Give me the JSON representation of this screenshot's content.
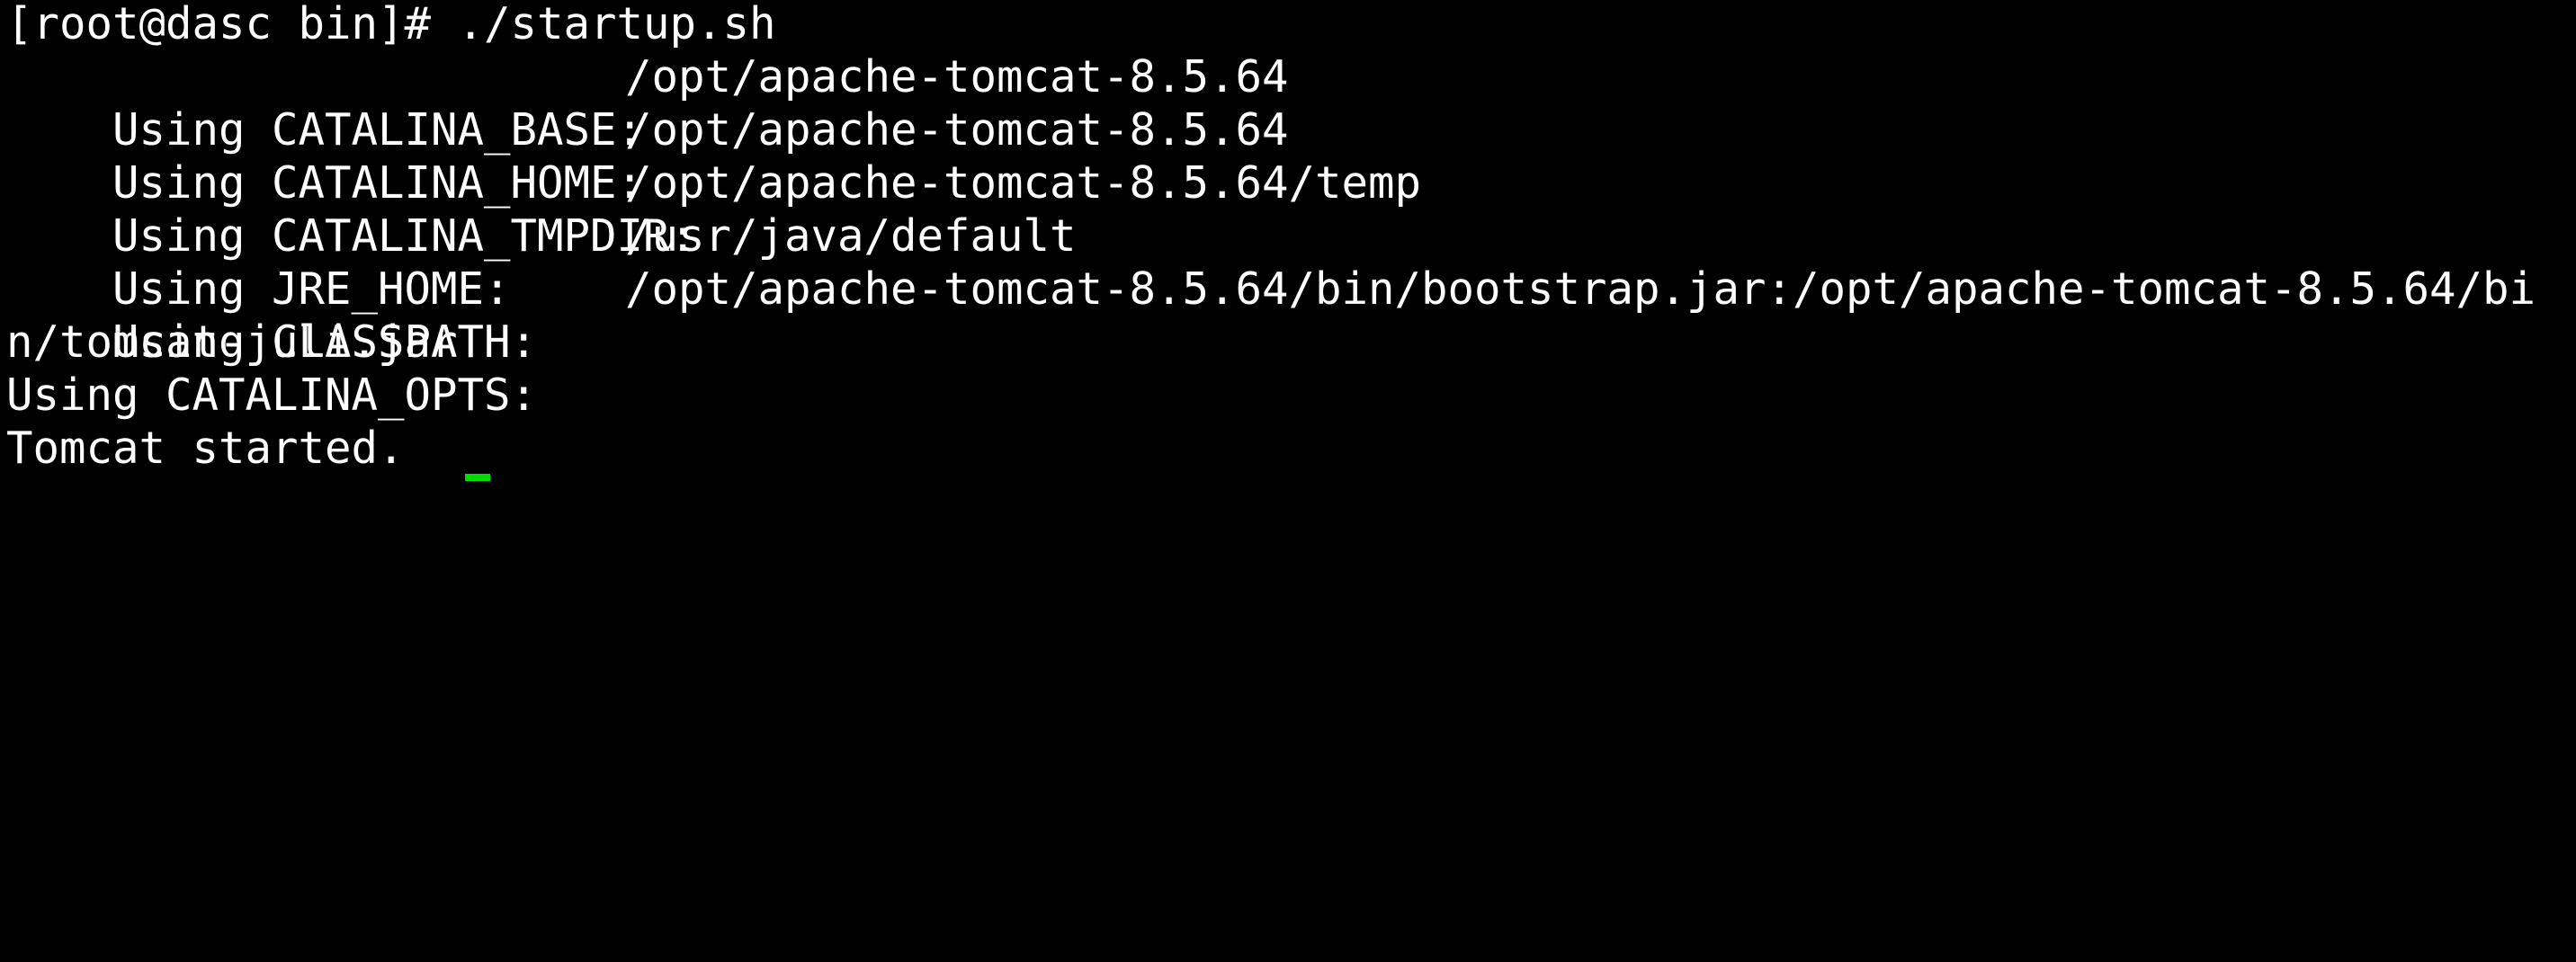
{
  "terminal": {
    "prompt": "[root@dasc bin]# ./startup.sh",
    "env": [
      {
        "label": "Using CATALINA_BASE:",
        "value": "/opt/apache-tomcat-8.5.64"
      },
      {
        "label": "Using CATALINA_HOME:",
        "value": "/opt/apache-tomcat-8.5.64"
      },
      {
        "label": "Using CATALINA_TMPDIR:",
        "value": "/opt/apache-tomcat-8.5.64/temp"
      },
      {
        "label": "Using JRE_HOME:",
        "value": "/usr/java/default"
      },
      {
        "label": "Using CLASSPATH:",
        "value": "/opt/apache-tomcat-8.5.64/bin/bootstrap.jar:/opt/apache-tomcat-8.5.64/bi"
      }
    ],
    "classpath_wrap": "n/tomcat-juli.jar",
    "catalina_opts": "Using CATALINA_OPTS:",
    "status": "Tomcat started.",
    "cursor_color": "#00dd00",
    "text_color": "#ffffff",
    "background_color": "#000000"
  }
}
